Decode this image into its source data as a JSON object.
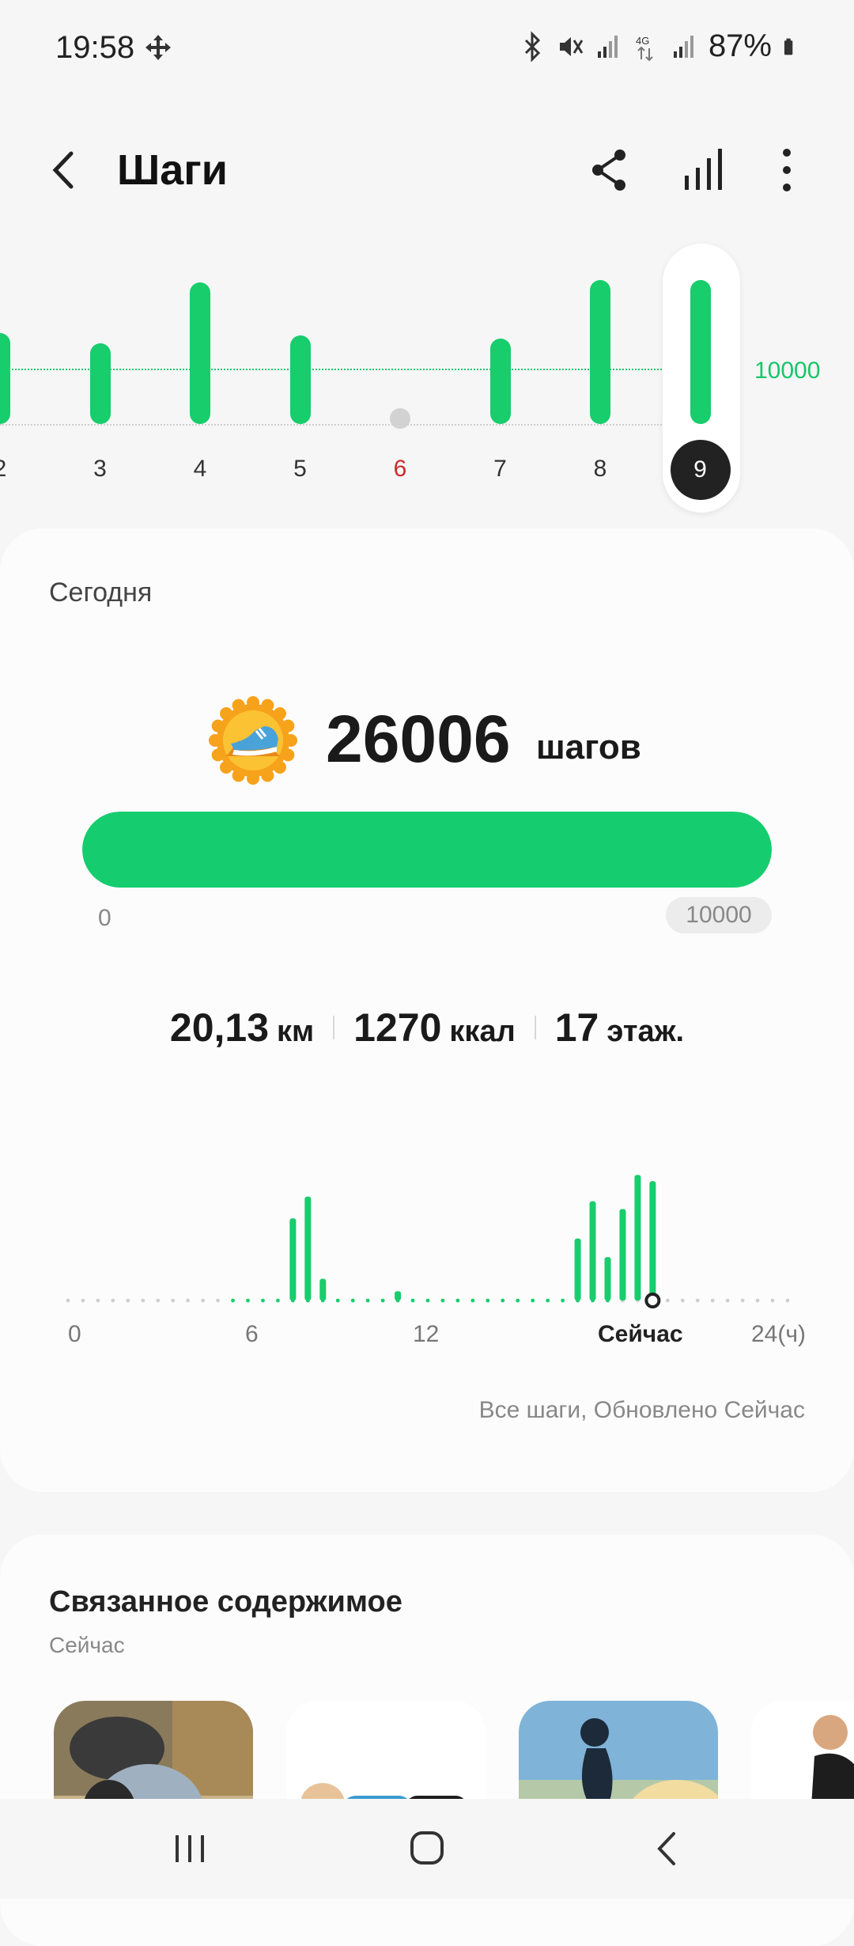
{
  "status_bar": {
    "time": "19:58",
    "battery": "87%"
  },
  "header": {
    "title": "Шаги"
  },
  "week": {
    "goal_label": "10000",
    "days": [
      {
        "label": "2",
        "fraction": 0.62
      },
      {
        "label": "3",
        "fraction": 0.55
      },
      {
        "label": "4",
        "fraction": 0.96
      },
      {
        "label": "5",
        "fraction": 0.6
      },
      {
        "label": "6",
        "fraction": 0
      },
      {
        "label": "7",
        "fraction": 0.58
      },
      {
        "label": "8",
        "fraction": 0.98
      },
      {
        "label": "9",
        "fraction": 0.98
      }
    ],
    "sunday_label": "6",
    "selected_label": "9"
  },
  "today": {
    "label": "Сегодня",
    "steps": "26006",
    "steps_unit": "шагов",
    "goal_progress": 1.0,
    "progress_min": "0",
    "progress_max": "10000",
    "metrics": [
      {
        "value": "20,13",
        "unit": "км"
      },
      {
        "value": "1270",
        "unit": "ккал"
      },
      {
        "value": "17",
        "unit": "этаж."
      }
    ],
    "hour_axis": [
      "0",
      "6",
      "12",
      "Сейчас",
      "24(ч)"
    ],
    "updated": "Все шаги, Обновлено Сейчас"
  },
  "chart_data": {
    "type": "bar",
    "x": [
      7.5,
      8.0,
      8.5,
      11.0,
      17.0,
      17.5,
      18.0,
      18.5,
      19.0,
      19.5
    ],
    "values": [
      0.53,
      0.67,
      0.14,
      0.06,
      0.4,
      0.64,
      0.28,
      0.59,
      0.81,
      0.77
    ],
    "xlabel": "",
    "ylabel": "",
    "xlim": [
      0,
      24
    ],
    "now_hour": 19.5
  },
  "related": {
    "title": "Связанное содержимое",
    "subtitle": "Сейчас"
  }
}
